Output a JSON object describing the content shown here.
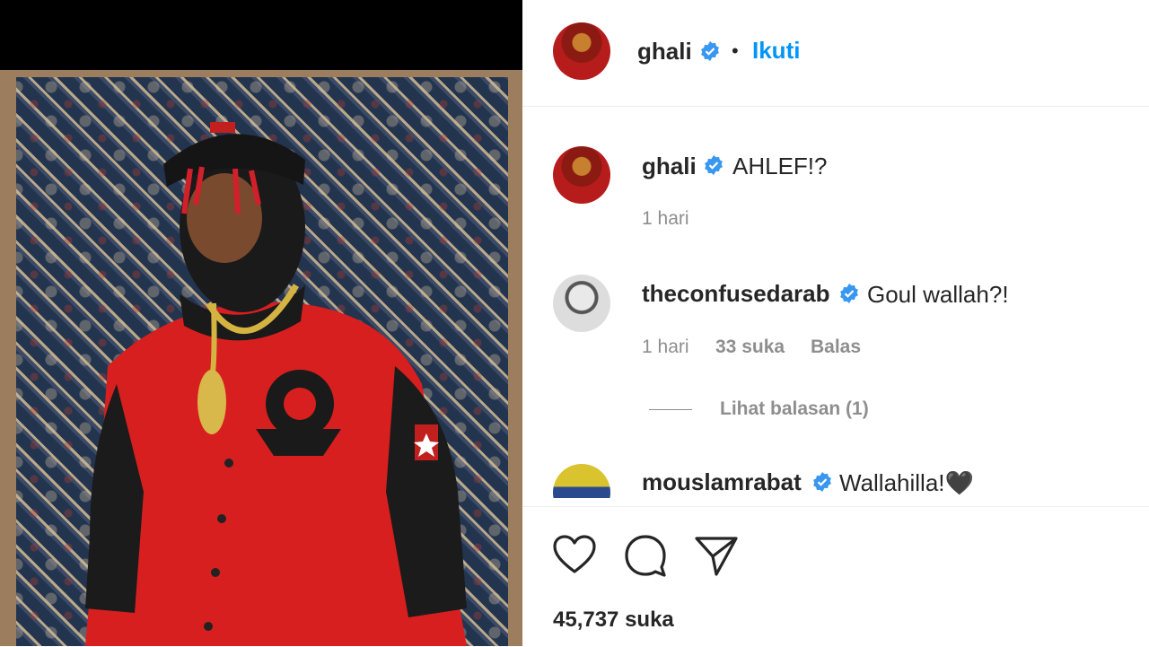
{
  "header": {
    "username": "ghali",
    "separator": "•",
    "follow_label": "Ikuti"
  },
  "comments": [
    {
      "username": "ghali",
      "text": "AHLEF!?",
      "time": "1 hari"
    },
    {
      "username": "theconfusedarab",
      "text": "Goul wallah?!",
      "time": "1 hari",
      "likes": "33 suka",
      "reply_label": "Balas",
      "view_replies": "Lihat balasan (1)"
    },
    {
      "username": "mouslamrabat",
      "text": "Wallahilla!🖤"
    }
  ],
  "actions": {
    "like_icon": "heart-icon",
    "comment_icon": "comment-icon",
    "share_icon": "send-icon",
    "likes_count": "45,737 suka"
  },
  "colors": {
    "link_blue": "#0095f6",
    "verified_blue": "#3897f0",
    "muted": "#8e8e8e"
  }
}
